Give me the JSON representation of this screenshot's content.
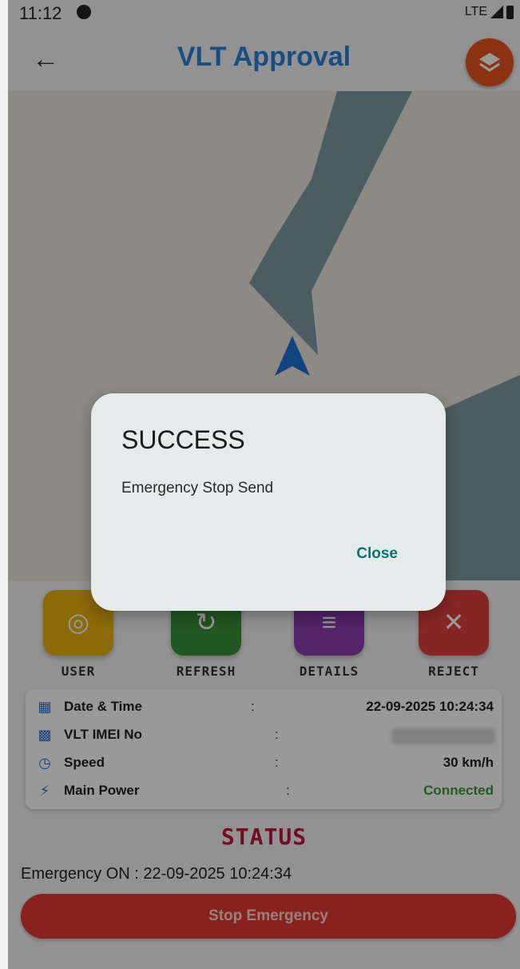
{
  "status_bar": {
    "time": "11:12",
    "network": "LTE"
  },
  "app_bar": {
    "title": "VLT Approval",
    "back_icon": "arrow-left-icon",
    "layers_icon": "layers-icon"
  },
  "colors": {
    "title": "#2a80d8",
    "layers_button": "#e8541e",
    "user": "#e8b10c",
    "refresh": "#3a8f3a",
    "details": "#8a3db0",
    "reject": "#e04040",
    "status": "#c0143c",
    "stop_button": "#e53935",
    "dialog_action": "#12706e"
  },
  "actions": [
    {
      "label": "USER",
      "icon": "target-icon"
    },
    {
      "label": "REFRESH",
      "icon": "refresh-icon"
    },
    {
      "label": "DETAILS",
      "icon": "list-icon"
    },
    {
      "label": "REJECT",
      "icon": "close-icon"
    }
  ],
  "info": {
    "rows": [
      {
        "icon": "calendar-icon",
        "label": "Date & Time",
        "value": "22-09-2025 10:24:34"
      },
      {
        "icon": "qr-icon",
        "label": "VLT IMEI No",
        "value": ""
      },
      {
        "icon": "speedometer-icon",
        "label": "Speed",
        "value": "30 km/h"
      },
      {
        "icon": "power-plug-icon",
        "label": "Main Power",
        "value": "Connected"
      }
    ],
    "separator": ":"
  },
  "status": {
    "heading": "STATUS",
    "emergency_text": "Emergency ON : 22-09-2025 10:24:34",
    "stop_button": "Stop Emergency"
  },
  "dialog": {
    "title": "SUCCESS",
    "message": "Emergency Stop Send",
    "close_label": "Close"
  }
}
